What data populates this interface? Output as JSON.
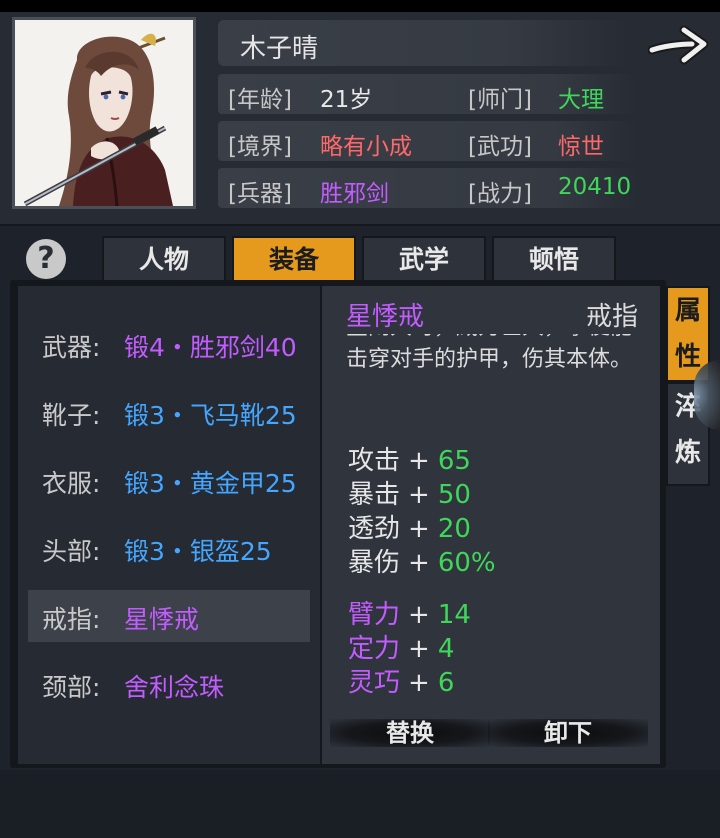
{
  "character": {
    "name": "木子晴",
    "fields": [
      {
        "label": "[年龄]",
        "value": "21岁",
        "color": "#e8e8e8"
      },
      {
        "label": "[师门]",
        "value": "大理",
        "color": "#3fd65a"
      },
      {
        "label": "[境界]",
        "value": "略有小成",
        "color": "#ff6868"
      },
      {
        "label": "[武功]",
        "value": "惊世",
        "color": "#ff6868"
      },
      {
        "label": "[兵器]",
        "value": "胜邪剑",
        "color": "#c35cff"
      },
      {
        "label": "[战力]",
        "value": "20410",
        "color": "#3fd65a"
      }
    ]
  },
  "help_label": "?",
  "tabs": [
    {
      "label": "人物",
      "active": false
    },
    {
      "label": "装备",
      "active": true
    },
    {
      "label": "武学",
      "active": false
    },
    {
      "label": "顿悟",
      "active": false
    }
  ],
  "slots": [
    {
      "label": "武器:",
      "value": "锻4・胜邪剑40",
      "color": "#c35cff",
      "selected": false
    },
    {
      "label": "靴子:",
      "value": "锻3・飞马靴25",
      "color": "#44a6ff",
      "selected": false
    },
    {
      "label": "衣服:",
      "value": "锻3・黄金甲25",
      "color": "#44a6ff",
      "selected": false
    },
    {
      "label": "头部:",
      "value": "锻3・银盔25",
      "color": "#44a6ff",
      "selected": false
    },
    {
      "label": "戒指:",
      "value": "星悸戒",
      "color": "#c35cff",
      "selected": true
    },
    {
      "label": "颈部:",
      "value": "舍利念珠",
      "color": "#c35cff",
      "selected": false
    }
  ],
  "detail": {
    "item_name": "星悸戒",
    "item_type": "戒指",
    "description": "星闹大时，威力巨大，拳便能击穿对手的护甲，伤其本体。",
    "stats": [
      {
        "label": "攻击",
        "value": "65",
        "label_color": "#e6e6e6"
      },
      {
        "label": "暴击",
        "value": "50",
        "label_color": "#e6e6e6"
      },
      {
        "label": "透劲",
        "value": "20",
        "label_color": "#e6e6e6"
      },
      {
        "label": "暴伤",
        "value": "60%",
        "label_color": "#e6e6e6"
      },
      {
        "label": "臂力",
        "value": "14",
        "label_color": "#c35cff"
      },
      {
        "label": "定力",
        "value": "4",
        "label_color": "#c35cff"
      },
      {
        "label": "灵巧",
        "value": "6",
        "label_color": "#c35cff"
      }
    ],
    "plus": "+",
    "replace_label": "替换",
    "unequip_label": "卸下"
  },
  "side_tabs": [
    {
      "chars": [
        "属",
        "性"
      ],
      "active": true
    },
    {
      "chars": [
        "淬",
        "炼"
      ],
      "active": false
    }
  ],
  "colors": {
    "accent": "#e59a1e",
    "stat_value": "#3fd65a",
    "rare": "#c35cff",
    "uncommon": "#44a6ff"
  },
  "icons": [
    "arrow-right-icon",
    "help-icon"
  ]
}
